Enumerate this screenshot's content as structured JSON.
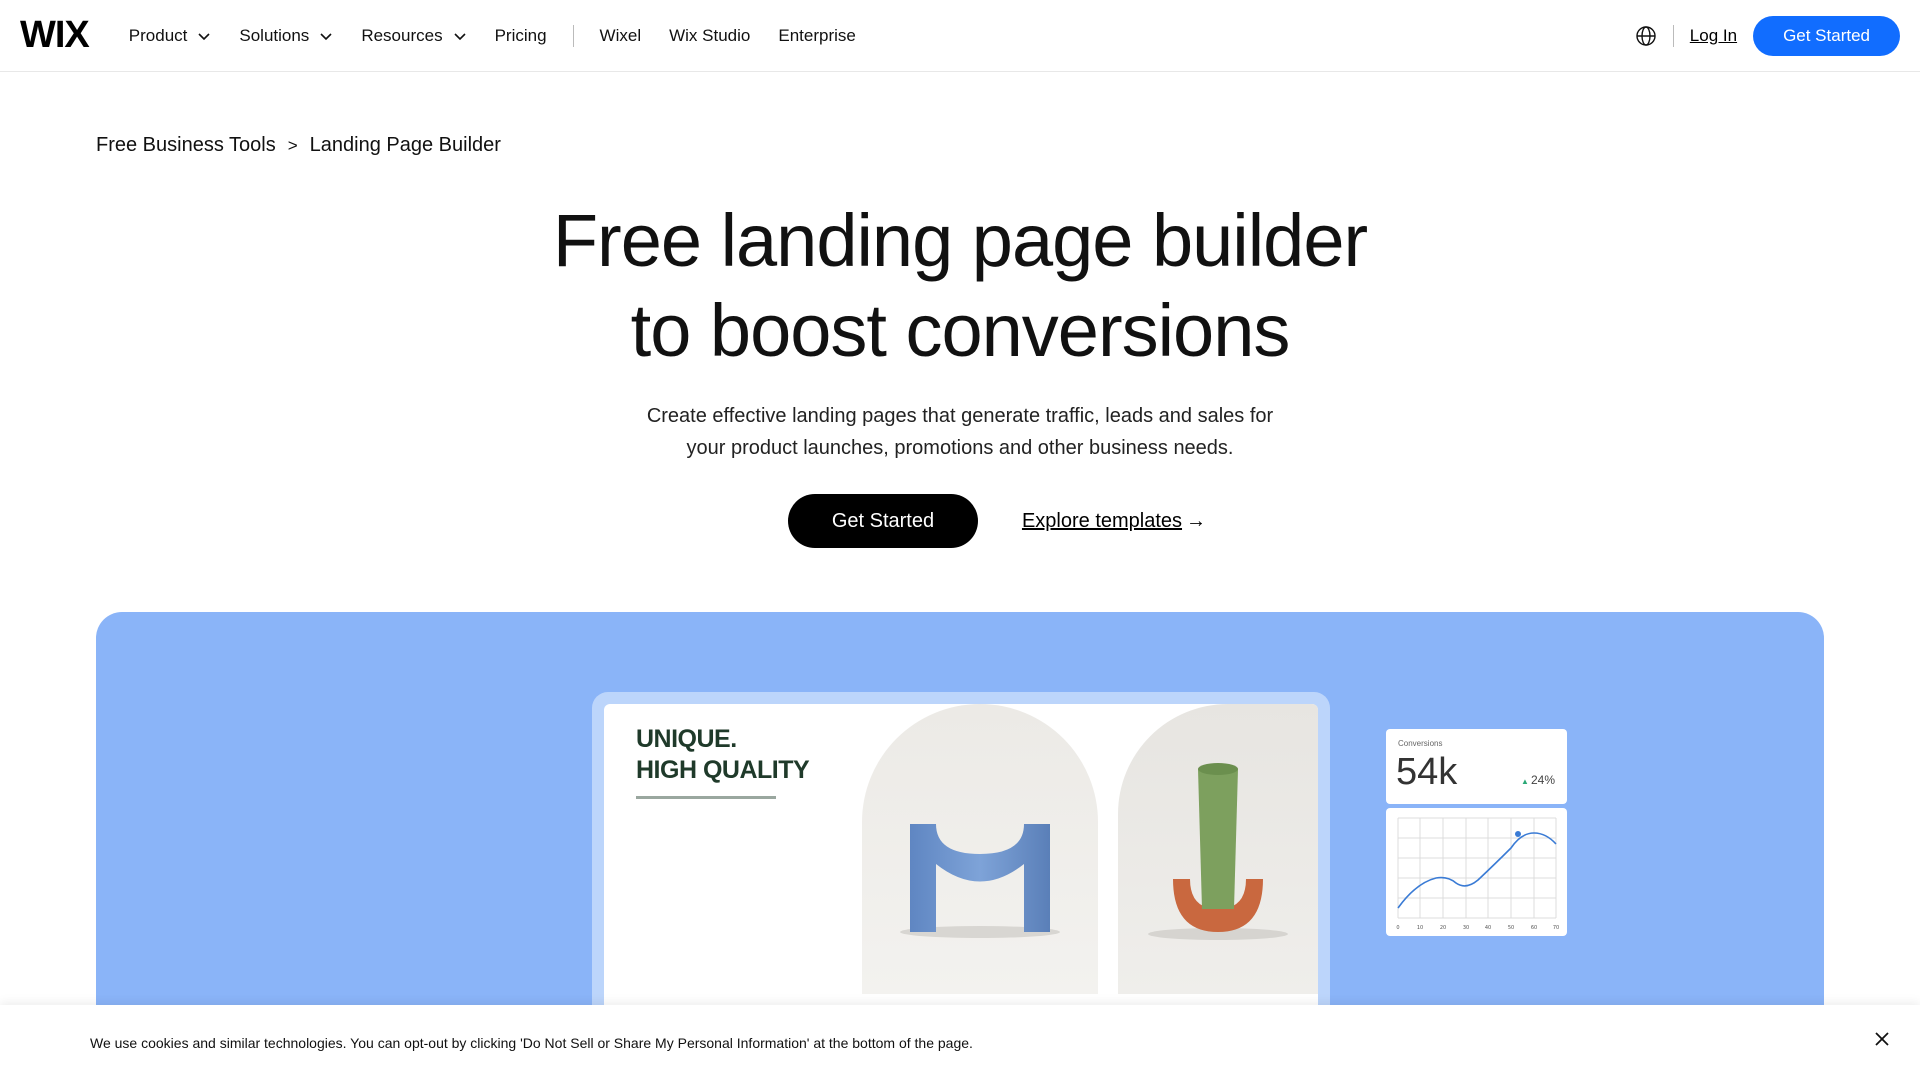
{
  "header": {
    "logo": "WIX",
    "nav": [
      {
        "label": "Product",
        "dropdown": true
      },
      {
        "label": "Solutions",
        "dropdown": true
      },
      {
        "label": "Resources",
        "dropdown": true
      },
      {
        "label": "Pricing",
        "dropdown": false
      }
    ],
    "nav_secondary": [
      "Wixel",
      "Wix Studio",
      "Enterprise"
    ],
    "login_label": "Log In",
    "cta_label": "Get Started",
    "accent": "#116dff"
  },
  "breadcrumb": {
    "parent": "Free Business Tools",
    "separator": ">",
    "current": "Landing Page Builder"
  },
  "hero": {
    "title_line1": "Free landing page builder",
    "title_line2": "to boost conversions",
    "subtitle_line1": "Create effective landing pages that generate traffic, leads and sales for",
    "subtitle_line2": "your product launches, promotions and other business needs.",
    "primary_cta": "Get Started",
    "secondary_cta": "Explore templates",
    "secondary_arrow": "→"
  },
  "showcase": {
    "background": "#8ab4f8",
    "tagline_line1": "UNIQUE.",
    "tagline_line2": "HIGH QUALITY",
    "stat": {
      "label": "Conversions",
      "value": "54k",
      "change": "24%"
    },
    "chart_ticks": [
      "0",
      "10",
      "20",
      "30",
      "40",
      "50",
      "60",
      "70"
    ]
  },
  "cookie": {
    "message": "We use cookies and similar technologies. You can opt-out by clicking 'Do Not Sell or Share My Personal Information' at the bottom of the page."
  }
}
